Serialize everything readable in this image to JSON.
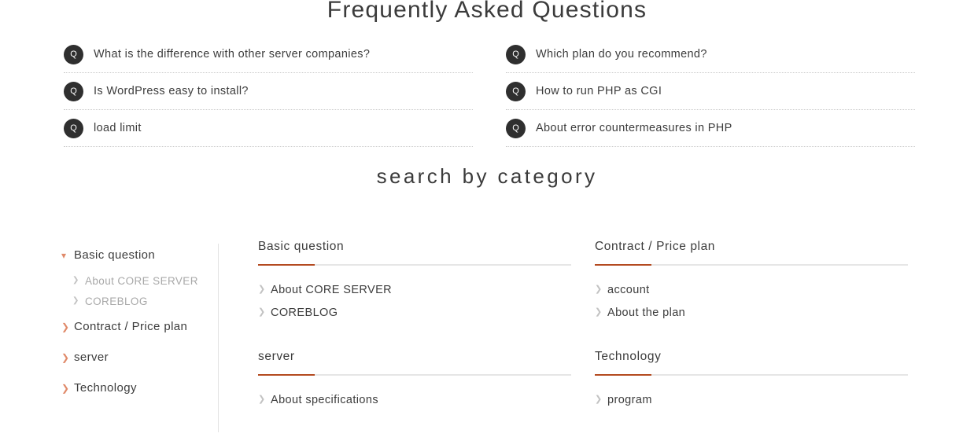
{
  "page": {
    "faq_heading": "Frequently Asked Questions",
    "category_heading": "search by category"
  },
  "faq": {
    "badge_label": "Q",
    "left_column": [
      {
        "question": "What is the difference with other server companies?"
      },
      {
        "question": "Is WordPress easy to install?"
      },
      {
        "question": "load limit"
      }
    ],
    "right_column": [
      {
        "question": "Which plan do you recommend?"
      },
      {
        "question": "How to run PHP as CGI"
      },
      {
        "question": "About error countermeasures in PHP"
      }
    ]
  },
  "sidebar": {
    "items": [
      {
        "label": "Basic question",
        "icon": "chevron-down-icon",
        "expanded": true
      },
      {
        "label": "About CORE SERVER",
        "icon": "chevron-right-icon",
        "sub": true
      },
      {
        "label": "COREBLOG",
        "icon": "chevron-right-icon",
        "sub": true
      },
      {
        "label": "Contract / Price plan",
        "icon": "chevron-right-icon"
      },
      {
        "label": "server",
        "icon": "chevron-right-icon"
      },
      {
        "label": "Technology",
        "icon": "chevron-right-icon"
      }
    ]
  },
  "categories": [
    {
      "title": "Basic question",
      "links": [
        {
          "label": "About CORE SERVER"
        },
        {
          "label": "COREBLOG"
        }
      ]
    },
    {
      "title": "Contract / Price plan",
      "links": [
        {
          "label": "account"
        },
        {
          "label": "About the plan"
        }
      ]
    },
    {
      "title": "server",
      "links": [
        {
          "label": "About specifications"
        }
      ]
    },
    {
      "title": "Technology",
      "links": [
        {
          "label": "program"
        }
      ]
    }
  ],
  "colors": {
    "accent_rule": "#b44a20",
    "accent_chevron": "#e08a6a",
    "badge_bg": "#2f2f2f",
    "text": "#3c3c3c",
    "muted_text": "#a8a8a8"
  }
}
